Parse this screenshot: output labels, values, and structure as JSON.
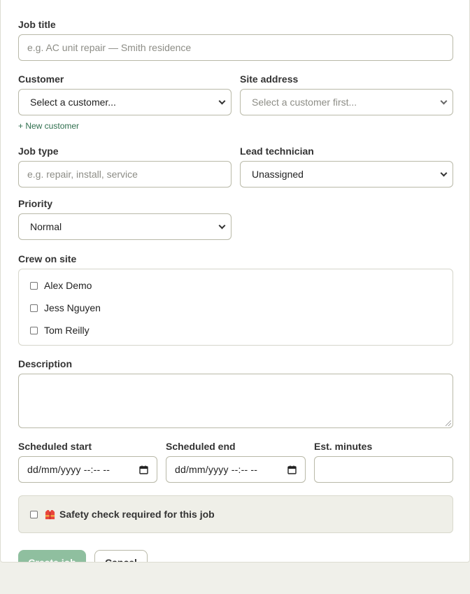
{
  "form": {
    "job_title": {
      "label": "Job title",
      "placeholder": "e.g. AC unit repair — Smith residence"
    },
    "customer": {
      "label": "Customer",
      "selected": "Select a customer...",
      "new_link": "+ New customer"
    },
    "site_address": {
      "label": "Site address",
      "selected": "Select a customer first..."
    },
    "job_type": {
      "label": "Job type",
      "placeholder": "e.g. repair, install, service"
    },
    "lead_technician": {
      "label": "Lead technician",
      "selected": "Unassigned"
    },
    "priority": {
      "label": "Priority",
      "selected": "Normal"
    },
    "crew": {
      "label": "Crew on site",
      "members": [
        {
          "name": "Alex Demo",
          "checked": false
        },
        {
          "name": "Jess Nguyen",
          "checked": false
        },
        {
          "name": "Tom Reilly",
          "checked": false
        }
      ]
    },
    "description": {
      "label": "Description",
      "value": ""
    },
    "scheduled_start": {
      "label": "Scheduled start",
      "value": "dd/mm/yyyy --:-- --"
    },
    "scheduled_end": {
      "label": "Scheduled end",
      "value": "dd/mm/yyyy --:-- --"
    },
    "est_minutes": {
      "label": "Est. minutes",
      "value": ""
    },
    "safety": {
      "label": "Safety check required for this job",
      "icon": "safety-vest-icon",
      "checked": false
    },
    "buttons": {
      "create": "Create job",
      "cancel": "Cancel"
    }
  },
  "colors": {
    "accent": "#2f6f4e",
    "primary_button": "#8fbf9f",
    "border": "#b9b9a8",
    "page_bg": "#f0f0ea"
  }
}
